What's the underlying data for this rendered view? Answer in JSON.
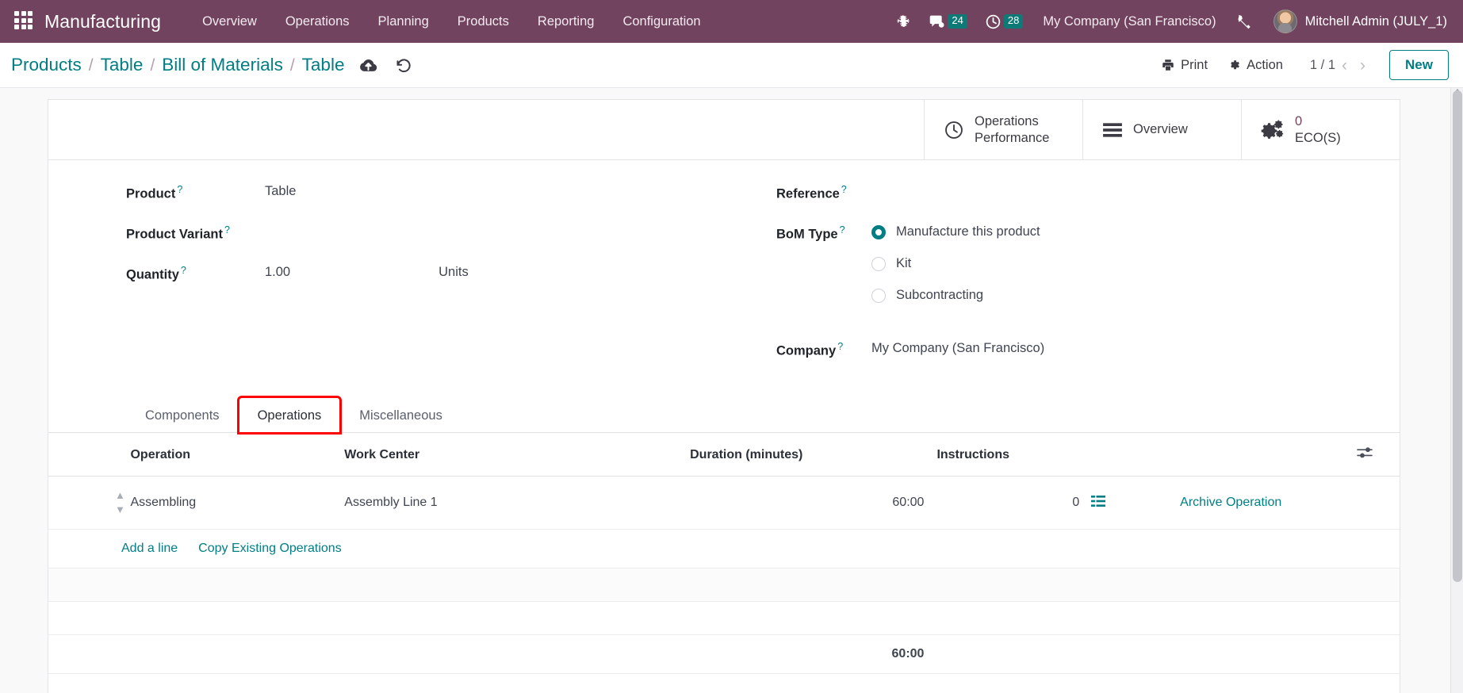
{
  "navbar": {
    "apps_icon": "apps-grid-icon",
    "brand": "Manufacturing",
    "menus": [
      {
        "label": "Overview"
      },
      {
        "label": "Operations"
      },
      {
        "label": "Planning"
      },
      {
        "label": "Products"
      },
      {
        "label": "Reporting"
      },
      {
        "label": "Configuration"
      }
    ],
    "debug_icon": "bug-icon",
    "messages": {
      "icon": "chat-bubble-icon",
      "count": "24"
    },
    "activities": {
      "icon": "clock-icon",
      "count": "28"
    },
    "company": "My Company (San Francisco)",
    "tools_icon": "tools-icon",
    "user": "Mitchell Admin (JULY_1)",
    "accent_bg": "#71435f",
    "badge_bg": "#0d7a77"
  },
  "control_panel": {
    "breadcrumb": [
      {
        "label": "Products"
      },
      {
        "label": "Table"
      },
      {
        "label": "Bill of Materials"
      },
      {
        "label": "Table"
      }
    ],
    "separator": "/",
    "save_icon": "cloud-upload-icon",
    "discard_icon": "undo-icon",
    "print_label": "Print",
    "print_icon": "printer-icon",
    "action_label": "Action",
    "action_icon": "gear-icon",
    "pager": "1 / 1",
    "prev_icon": "chevron-left-icon",
    "next_icon": "chevron-right-icon",
    "new_label": "New",
    "accent": "#017e84"
  },
  "stat_buttons": [
    {
      "icon": "clock-icon",
      "line1": "Operations",
      "line2": "Performance",
      "value": ""
    },
    {
      "icon": "list-icon",
      "line1": "Overview",
      "line2": "",
      "value": ""
    },
    {
      "icon": "gears-icon",
      "line1": "ECO(S)",
      "line2": "",
      "value": "0"
    }
  ],
  "form": {
    "left": [
      {
        "label": "Product",
        "help": "?",
        "value": "Table"
      },
      {
        "label": "Product Variant",
        "help": "?",
        "value": ""
      },
      {
        "label": "Quantity",
        "help": "?",
        "value": "1.00",
        "uom": "Units"
      }
    ],
    "right": {
      "reference": {
        "label": "Reference",
        "help": "?",
        "value": ""
      },
      "bom_type": {
        "label": "BoM Type",
        "help": "?",
        "options": [
          {
            "label": "Manufacture this product",
            "selected": true
          },
          {
            "label": "Kit",
            "selected": false
          },
          {
            "label": "Subcontracting",
            "selected": false
          }
        ]
      },
      "company": {
        "label": "Company",
        "help": "?",
        "value": "My Company (San Francisco)"
      }
    }
  },
  "notebook": {
    "tabs": [
      {
        "label": "Components",
        "active": false,
        "annotated": false
      },
      {
        "label": "Operations",
        "active": true,
        "annotated": true
      },
      {
        "label": "Miscellaneous",
        "active": false,
        "annotated": false
      }
    ],
    "annotation_color": "#ff0000"
  },
  "operations_table": {
    "columns": [
      "Operation",
      "Work Center",
      "Duration (minutes)",
      "Instructions"
    ],
    "optional_columns_icon": "sliders-icon",
    "rows": [
      {
        "handle_icon": "drag-handle-icon",
        "operation": "Assembling",
        "work_center": "Assembly Line 1",
        "duration": "60:00",
        "instructions": "0",
        "instructions_icon": "list-lines-icon",
        "row_button": "Archive Operation"
      }
    ],
    "add_line": "Add a line",
    "copy_existing": "Copy Existing Operations",
    "total_duration": "60:00"
  }
}
